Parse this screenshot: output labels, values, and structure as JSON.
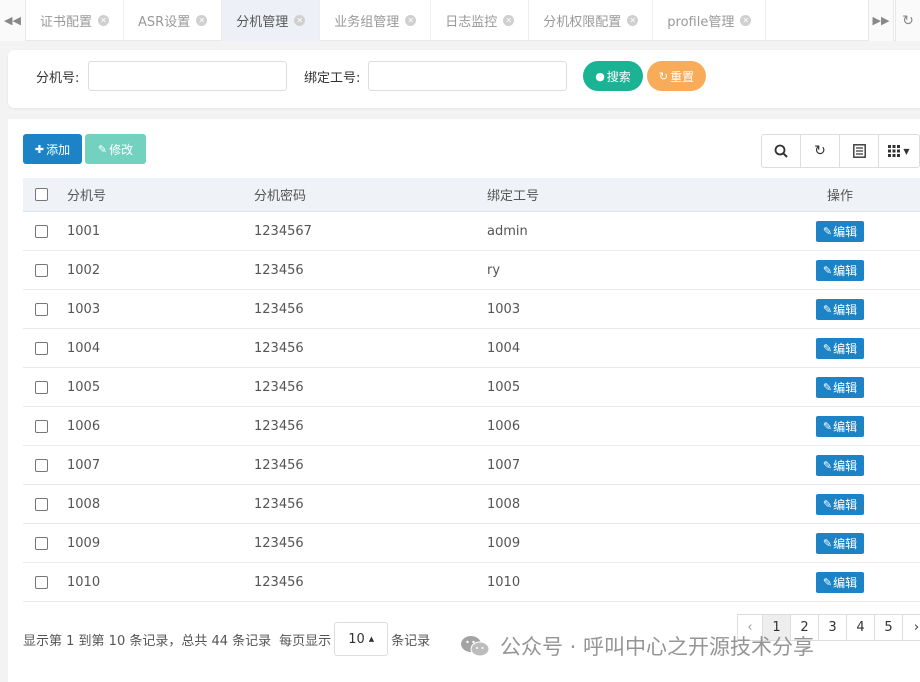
{
  "tabs": {
    "items": [
      {
        "label": "证书配置"
      },
      {
        "label": "ASR设置"
      },
      {
        "label": "分机管理"
      },
      {
        "label": "业务组管理"
      },
      {
        "label": "日志监控"
      },
      {
        "label": "分机权限配置"
      },
      {
        "label": "profile管理"
      }
    ],
    "active_index": 2
  },
  "search": {
    "ext_label": "分机号:",
    "ext_value": "",
    "agent_label": "绑定工号:",
    "agent_value": "",
    "search_button": "搜索",
    "reset_button": "重置"
  },
  "toolbar": {
    "add_button": "添加",
    "edit_button": "修改"
  },
  "table": {
    "columns": [
      "分机号",
      "分机密码",
      "绑定工号",
      "操作"
    ],
    "row_action": "编辑",
    "rows": [
      {
        "ext": "1001",
        "password": "1234567",
        "agent": "admin"
      },
      {
        "ext": "1002",
        "password": "123456",
        "agent": "ry"
      },
      {
        "ext": "1003",
        "password": "123456",
        "agent": "1003"
      },
      {
        "ext": "1004",
        "password": "123456",
        "agent": "1004"
      },
      {
        "ext": "1005",
        "password": "123456",
        "agent": "1005"
      },
      {
        "ext": "1006",
        "password": "123456",
        "agent": "1006"
      },
      {
        "ext": "1007",
        "password": "123456",
        "agent": "1007"
      },
      {
        "ext": "1008",
        "password": "123456",
        "agent": "1008"
      },
      {
        "ext": "1009",
        "password": "123456",
        "agent": "1009"
      },
      {
        "ext": "1010",
        "password": "123456",
        "agent": "1010"
      }
    ]
  },
  "pagination": {
    "summary": "显示第 1 到第 10 条记录，总共 44 条记录",
    "per_page_prefix": "每页显示",
    "page_size": "10",
    "per_page_suffix": "条记录",
    "prev": "‹",
    "pages": [
      "1",
      "2",
      "3",
      "4",
      "5",
      "›"
    ],
    "current": "1"
  },
  "watermark": "公众号 · 呼叫中心之开源技术分享",
  "colors": {
    "primary": "#1c84c6",
    "search": "#1ab394",
    "reset": "#f8ac59",
    "edit_disabled": "#73d1c0"
  }
}
